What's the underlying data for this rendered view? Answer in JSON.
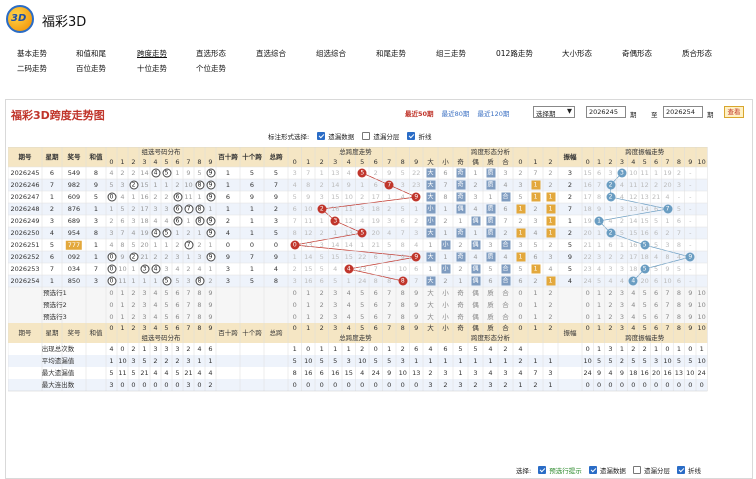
{
  "app": {
    "title": "福彩3D",
    "logo_text": "3D"
  },
  "nav": [
    [
      "基本走势",
      "和值和尾",
      "跨度走势",
      "直选形态",
      "直选综合",
      "组选综合",
      "和尾走势",
      "组三走势",
      "012路走势",
      "大小形态",
      "奇偶形态",
      "质合形态"
    ],
    [
      "二码走势",
      "百位走势",
      "十位走势",
      "个位走势"
    ]
  ],
  "nav_active": "跨度走势",
  "panel": {
    "title": "福彩3D跨度走势图",
    "recent": [
      "最近50期",
      "最近80期",
      "最近120期"
    ],
    "recent_active": 0,
    "select_label": "选择期",
    "from": "2026245",
    "to": "2026254",
    "qi": "期",
    "zhi": "至",
    "query": "查看"
  },
  "options": {
    "label": "标注形式选择:",
    "items": [
      {
        "label": "遗漏数据",
        "checked": true
      },
      {
        "label": "遗漏分层",
        "checked": false
      },
      {
        "label": "折线",
        "checked": true
      }
    ]
  },
  "footer": {
    "label": "选择:",
    "items": [
      {
        "label": "预选行提示",
        "checked": true,
        "green": true
      },
      {
        "label": "遗漏数据",
        "checked": true
      },
      {
        "label": "遗漏分层",
        "checked": false
      },
      {
        "label": "折线",
        "checked": true
      }
    ]
  },
  "colors": {
    "header_bg": "#f5e6c4",
    "stripe": "#eef3fb",
    "ball_red": "#c0352b",
    "ball_blue": "#6b8db5",
    "box_gold": "#e3a83c",
    "box_blue": "#9fb8d6"
  },
  "table": {
    "headers": {
      "qihao": "期号",
      "xingqi": "星期",
      "jianghao": "奖号",
      "hezhi": "和值",
      "group_dist": "组选号码分布",
      "bai_shi": "百十跨",
      "shi_ge": "十个跨",
      "zongkua": "总跨",
      "zongkua_trend": "总跨度走势",
      "form": "跨度形态分析",
      "zhenfu": "振幅",
      "zhenfu_trend": "跨度振幅走势",
      "da": "大",
      "xiao": "小",
      "ji": "奇",
      "ou": "偶",
      "zhi": "质",
      "he": "合"
    },
    "digits": [
      "0",
      "1",
      "2",
      "3",
      "4",
      "5",
      "6",
      "7",
      "8",
      "9"
    ],
    "r012": [
      "0",
      "1",
      "2"
    ],
    "rows": [
      {
        "q": "2026245",
        "w": "6",
        "n": "549",
        "s": "8",
        "d": [
          "4",
          "2",
          "2",
          "14",
          "④",
          "⑤",
          "1",
          "9",
          "5",
          "⑨"
        ],
        "bs": "1",
        "sg": "5",
        "k": "5",
        "kt": [
          "3",
          "7",
          "1",
          "13",
          "4",
          "5",
          "2",
          "9",
          "5",
          "22"
        ],
        "f": [
          "大",
          "6",
          "奇",
          "1",
          "质",
          "3",
          "2",
          "7",
          "2"
        ],
        "z": "3",
        "zt": [
          "15",
          "6",
          "3",
          "3",
          "10",
          "11",
          "1",
          "19",
          "2",
          "-"
        ]
      },
      {
        "q": "2026246",
        "w": "7",
        "n": "982",
        "s": "9",
        "d": [
          "5",
          "3",
          "②",
          "15",
          "1",
          "1",
          "2",
          "10",
          "⑧",
          "⑨"
        ],
        "bs": "1",
        "sg": "6",
        "k": "7",
        "kt": [
          "4",
          "8",
          "2",
          "14",
          "9",
          "1",
          "6",
          "7",
          "3",
          "23"
        ],
        "f": [
          "大",
          "7",
          "奇",
          "2",
          "质",
          "4",
          "3",
          "1",
          "2"
        ],
        "z": "2",
        "zt": [
          "16",
          "7",
          "2",
          "4",
          "11",
          "12",
          "2",
          "20",
          "3",
          "-"
        ]
      },
      {
        "q": "2026247",
        "w": "1",
        "n": "609",
        "s": "5",
        "d": [
          "⓪",
          "4",
          "1",
          "16",
          "2",
          "2",
          "⑥",
          "11",
          "1",
          "⑨"
        ],
        "bs": "6",
        "sg": "9",
        "k": "9",
        "kt": [
          "5",
          "9",
          "3",
          "15",
          "10",
          "2",
          "17",
          "1",
          "4",
          "9"
        ],
        "f": [
          "大",
          "8",
          "奇",
          "3",
          "1",
          "合",
          "5",
          "1",
          "1"
        ],
        "z": "2",
        "zt": [
          "17",
          "8",
          "2",
          "4",
          "12",
          "13",
          "21",
          "4",
          "-",
          "-"
        ]
      },
      {
        "q": "2026248",
        "w": "2",
        "n": "876",
        "s": "1",
        "d": [
          "1",
          "5",
          "2",
          "17",
          "3",
          "3",
          "⑥",
          "⑦",
          "⑧",
          "1"
        ],
        "bs": "1",
        "sg": "1",
        "k": "2",
        "kt": [
          "6",
          "10",
          "2",
          "16",
          "11",
          "3",
          "18",
          "2",
          "5",
          "1"
        ],
        "f": [
          "小",
          "1",
          "偶",
          "4",
          "质",
          "6",
          "1",
          "2",
          "1"
        ],
        "z": "7",
        "zt": [
          "18",
          "9",
          "1",
          "3",
          "13",
          "14",
          "6",
          "7",
          "5",
          "-"
        ]
      },
      {
        "q": "2026249",
        "w": "3",
        "n": "689",
        "s": "3",
        "d": [
          "2",
          "6",
          "3",
          "18",
          "4",
          "4",
          "⑥",
          "1",
          "⑧",
          "⑨"
        ],
        "bs": "2",
        "sg": "1",
        "k": "3",
        "kt": [
          "7",
          "11",
          "1",
          "3",
          "12",
          "4",
          "19",
          "3",
          "6",
          "2"
        ],
        "f": [
          "小",
          "2",
          "1",
          "偶",
          "质",
          "7",
          "2",
          "3",
          "1"
        ],
        "z": "1",
        "zt": [
          "19",
          "1",
          "4",
          "2",
          "14",
          "15",
          "5",
          "1",
          "6",
          "-"
        ]
      },
      {
        "q": "2026250",
        "w": "4",
        "n": "954",
        "s": "8",
        "d": [
          "3",
          "7",
          "4",
          "19",
          "④",
          "⑤",
          "1",
          "2",
          "1",
          "⑨"
        ],
        "bs": "4",
        "sg": "1",
        "k": "5",
        "kt": [
          "8",
          "12",
          "2",
          "1",
          "13",
          "5",
          "20",
          "4",
          "7",
          "3"
        ],
        "f": [
          "大",
          "1",
          "奇",
          "1",
          "质",
          "2",
          "1",
          "4",
          "1"
        ],
        "z": "2",
        "zt": [
          "20",
          "1",
          "2",
          "5",
          "15",
          "16",
          "6",
          "2",
          "7",
          "-"
        ]
      },
      {
        "q": "2026251",
        "w": "5",
        "n": "777",
        "s": "1",
        "d": [
          "4",
          "8",
          "5",
          "20",
          "1",
          "1",
          "2",
          "⑦",
          "2",
          "1"
        ],
        "bs": "0",
        "sg": "0",
        "k": "0",
        "kt": [
          "0",
          "13",
          "3",
          "14",
          "14",
          "1",
          "21",
          "5",
          "8",
          "4"
        ],
        "f": [
          "1",
          "小",
          "2",
          "偶",
          "3",
          "合",
          "3",
          "5",
          "2"
        ],
        "z": "5",
        "zt": [
          "21",
          "1",
          "6",
          "1",
          "16",
          "17",
          "5",
          "3",
          "8",
          "-"
        ]
      },
      {
        "q": "2026252",
        "w": "6",
        "n": "092",
        "s": "1",
        "d": [
          "⓪",
          "9",
          "②",
          "21",
          "2",
          "2",
          "3",
          "1",
          "3",
          "⑨"
        ],
        "bs": "9",
        "sg": "7",
        "k": "9",
        "kt": [
          "1",
          "14",
          "5",
          "15",
          "15",
          "22",
          "6",
          "9",
          "9",
          "5"
        ],
        "f": [
          "大",
          "1",
          "奇",
          "4",
          "质",
          "4",
          "1",
          "6",
          "3"
        ],
        "z": "9",
        "zt": [
          "22",
          "3",
          "2",
          "2",
          "17",
          "18",
          "4",
          "8",
          "4",
          "9"
        ]
      },
      {
        "q": "2026253",
        "w": "7",
        "n": "034",
        "s": "7",
        "d": [
          "⓪",
          "10",
          "1",
          "③",
          "④",
          "3",
          "4",
          "2",
          "4",
          "1"
        ],
        "bs": "3",
        "sg": "1",
        "k": "4",
        "kt": [
          "2",
          "15",
          "5",
          "4",
          "16",
          "23",
          "7",
          "1",
          "10",
          "6"
        ],
        "f": [
          "1",
          "小",
          "2",
          "偶",
          "5",
          "合",
          "5",
          "1",
          "4"
        ],
        "z": "5",
        "zt": [
          "23",
          "4",
          "3",
          "3",
          "18",
          "19",
          "5",
          "9",
          "5",
          "-"
        ]
      },
      {
        "q": "2026254",
        "w": "1",
        "n": "850",
        "s": "3",
        "d": [
          "⓪",
          "11",
          "1",
          "1",
          "1",
          "⑤",
          "5",
          "3",
          "⑧",
          "2"
        ],
        "bs": "3",
        "sg": "5",
        "k": "8",
        "kt": [
          "3",
          "16",
          "6",
          "5",
          "1",
          "24",
          "8",
          "8",
          "11",
          "7"
        ],
        "f": [
          "大",
          "2",
          "1",
          "偶",
          "6",
          "合",
          "6",
          "2",
          "1"
        ],
        "z": "4",
        "zt": [
          "24",
          "5",
          "4",
          "4",
          "19",
          "20",
          "6",
          "10",
          "6",
          "-"
        ]
      }
    ],
    "hits": [
      5,
      7,
      9,
      2,
      3,
      5,
      0,
      9,
      4,
      8
    ],
    "zhenfu_hits": [
      3,
      2,
      2,
      7,
      1,
      2,
      5,
      9,
      5,
      4
    ],
    "presel": [
      {
        "label": "预选行1"
      },
      {
        "label": "预选行2"
      },
      {
        "label": "预选行3"
      }
    ],
    "stats": [
      {
        "label": "出现总次数",
        "d": [
          "4",
          "0",
          "2",
          "1",
          "3",
          "3",
          "3",
          "2",
          "4",
          "6"
        ],
        "k": [
          "1",
          "0",
          "1",
          "1",
          "1",
          "2",
          "0",
          "1",
          "2",
          "6"
        ],
        "f": [
          "4",
          "6",
          "5",
          "5",
          "4",
          "2",
          "4"
        ],
        "z": [
          "0",
          "1",
          "3",
          "1",
          "2",
          "2",
          "1",
          "0",
          "1",
          "0",
          "1"
        ]
      },
      {
        "label": "平均遗漏值",
        "d": [
          "1",
          "10",
          "3",
          "5",
          "2",
          "2",
          "2",
          "3",
          "1",
          "1"
        ],
        "k": [
          "5",
          "10",
          "5",
          "5",
          "3",
          "10",
          "5",
          "5",
          "3",
          "1"
        ],
        "f": [
          "1",
          "1",
          "1",
          "1",
          "1",
          "1",
          "2",
          "1",
          "1"
        ],
        "z": [
          "10",
          "5",
          "5",
          "2",
          "5",
          "5",
          "3",
          "10",
          "5",
          "5",
          "10"
        ]
      },
      {
        "label": "最大遗漏值",
        "d": [
          "5",
          "11",
          "5",
          "21",
          "4",
          "4",
          "5",
          "21",
          "4",
          "4"
        ],
        "k": [
          "8",
          "16",
          "6",
          "16",
          "15",
          "4",
          "24",
          "9",
          "10",
          "13"
        ],
        "f": [
          "2",
          "3",
          "1",
          "3",
          "4",
          "3",
          "4",
          "7",
          "3"
        ],
        "z": [
          "24",
          "9",
          "4",
          "9",
          "18",
          "16",
          "20",
          "16",
          "13",
          "10",
          "24"
        ]
      },
      {
        "label": "最大连出数",
        "d": [
          "3",
          "0",
          "0",
          "0",
          "0",
          "0",
          "0",
          "3",
          "0",
          "2"
        ],
        "k": [
          "0",
          "0",
          "0",
          "0",
          "0",
          "0",
          "0",
          "0",
          "0",
          "0"
        ],
        "f": [
          "3",
          "2",
          "3",
          "2",
          "3",
          "2",
          "1",
          "2",
          "1"
        ],
        "z": [
          "0",
          "0",
          "0",
          "0",
          "0",
          "0",
          "0",
          "0",
          "0",
          "0",
          "0"
        ]
      }
    ]
  }
}
